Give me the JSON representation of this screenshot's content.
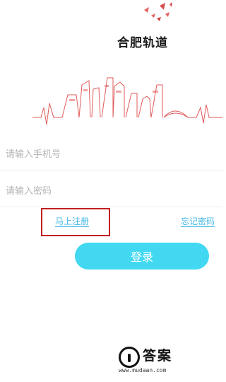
{
  "app": {
    "title": "合肥轨道"
  },
  "login_form": {
    "phone_placeholder": "请输入手机号",
    "password_placeholder": "请输入密码",
    "register_link": "马上注册",
    "forgot_password_link": "忘记密码",
    "login_button": "登录"
  },
  "watermark": {
    "title": "答案",
    "url": "www.mudaan.com"
  },
  "colors": {
    "accent": "#43d8f2",
    "link": "#43b7e6",
    "highlight_box": "#c21f1f",
    "skyline": "#e05a5a"
  }
}
